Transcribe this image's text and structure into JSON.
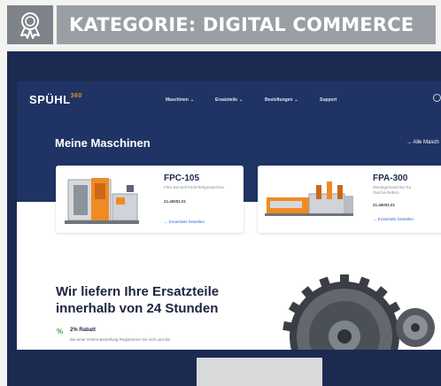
{
  "category": {
    "title": "KATEGORIE: DIGITAL COMMERCE",
    "icon": "award-ribbon-icon"
  },
  "site": {
    "logo_text": "SPÜHL",
    "logo_sup": "360",
    "nav": [
      {
        "label": "Maschinen",
        "chevron": "⌄"
      },
      {
        "label": "Ersatzteile",
        "chevron": "⌄"
      },
      {
        "label": "Bestellungen",
        "chevron": "⌄"
      },
      {
        "label": "Support",
        "chevron": ""
      }
    ]
  },
  "hero": {
    "title": "Meine Maschinen",
    "link": "→  Alle Masch"
  },
  "machines": [
    {
      "model": "FPC-105",
      "description": "Flexi Bonnell Federfertigmaschine",
      "number": "21.46001.01",
      "cta": "→  Ersatzteile bestellen"
    },
    {
      "model": "FPA-300",
      "description": "Montagemaschine für Taschenfedern",
      "number": "21.46001.01",
      "cta": "→  Ersatzteile bestellen"
    }
  ],
  "promo": {
    "title_line1": "Wir liefern Ihre Ersatzteile",
    "title_line2": "innerhalb von 24 Stunden",
    "benefit_icon": "%",
    "benefit_label": "2% Rabatt",
    "benefit_text": "Bei einer Online-Bestellung Registrieren Sie sich und die"
  },
  "colors": {
    "navy": "#1f3464",
    "accent": "#f08a24",
    "link": "#2a6ac9",
    "banner": "#9a9fa5"
  }
}
